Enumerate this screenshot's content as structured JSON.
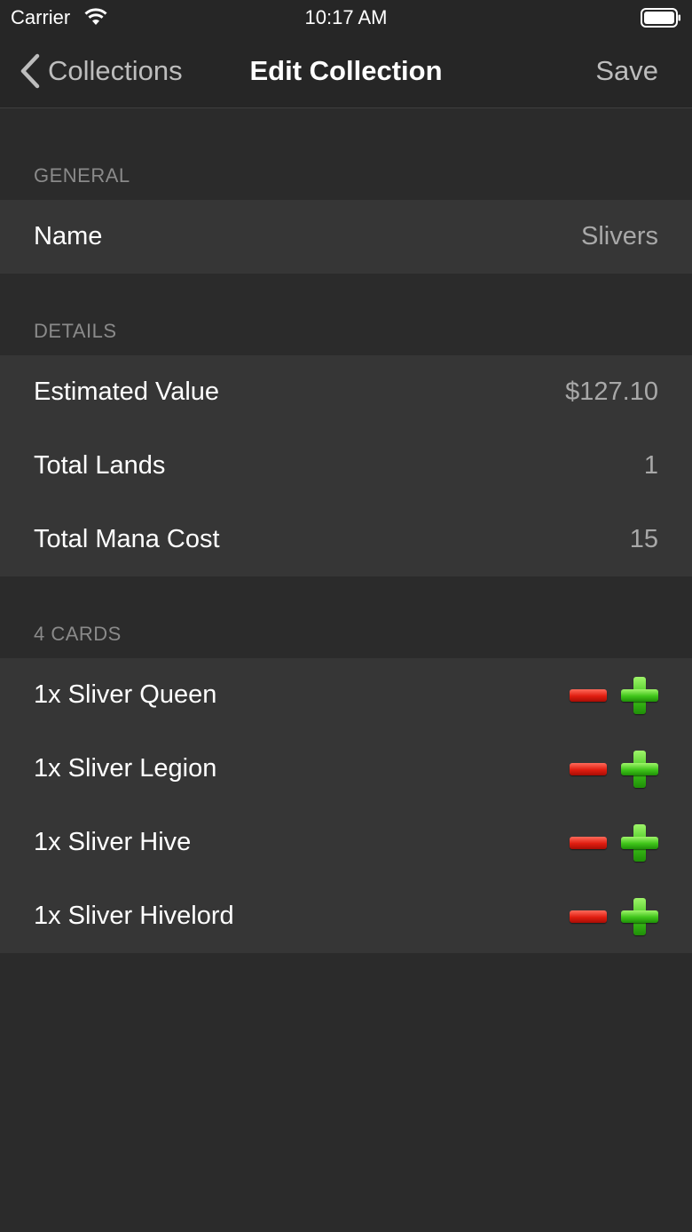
{
  "status_bar": {
    "carrier": "Carrier",
    "time": "10:17 AM"
  },
  "nav": {
    "back_label": "Collections",
    "title": "Edit Collection",
    "save_label": "Save"
  },
  "general": {
    "header": "GENERAL",
    "name_label": "Name",
    "name_value": "Slivers"
  },
  "details": {
    "header": "DETAILS",
    "rows": [
      {
        "label": "Estimated Value",
        "value": "$127.10"
      },
      {
        "label": "Total Lands",
        "value": "1"
      },
      {
        "label": "Total Mana Cost",
        "value": "15"
      }
    ]
  },
  "cards": {
    "header": "4 CARDS",
    "items": [
      {
        "label": "1x Sliver Queen"
      },
      {
        "label": "1x Sliver Legion"
      },
      {
        "label": "1x Sliver Hive"
      },
      {
        "label": "1x Sliver Hivelord"
      }
    ]
  },
  "icons": {
    "back": "chevron-left-icon",
    "wifi": "wifi-icon",
    "battery": "battery-icon",
    "minus": "minus-icon",
    "plus": "plus-icon"
  },
  "colors": {
    "background": "#2b2b2b",
    "group": "#363636",
    "minus": "#e01d10",
    "plus": "#3fc51a"
  }
}
